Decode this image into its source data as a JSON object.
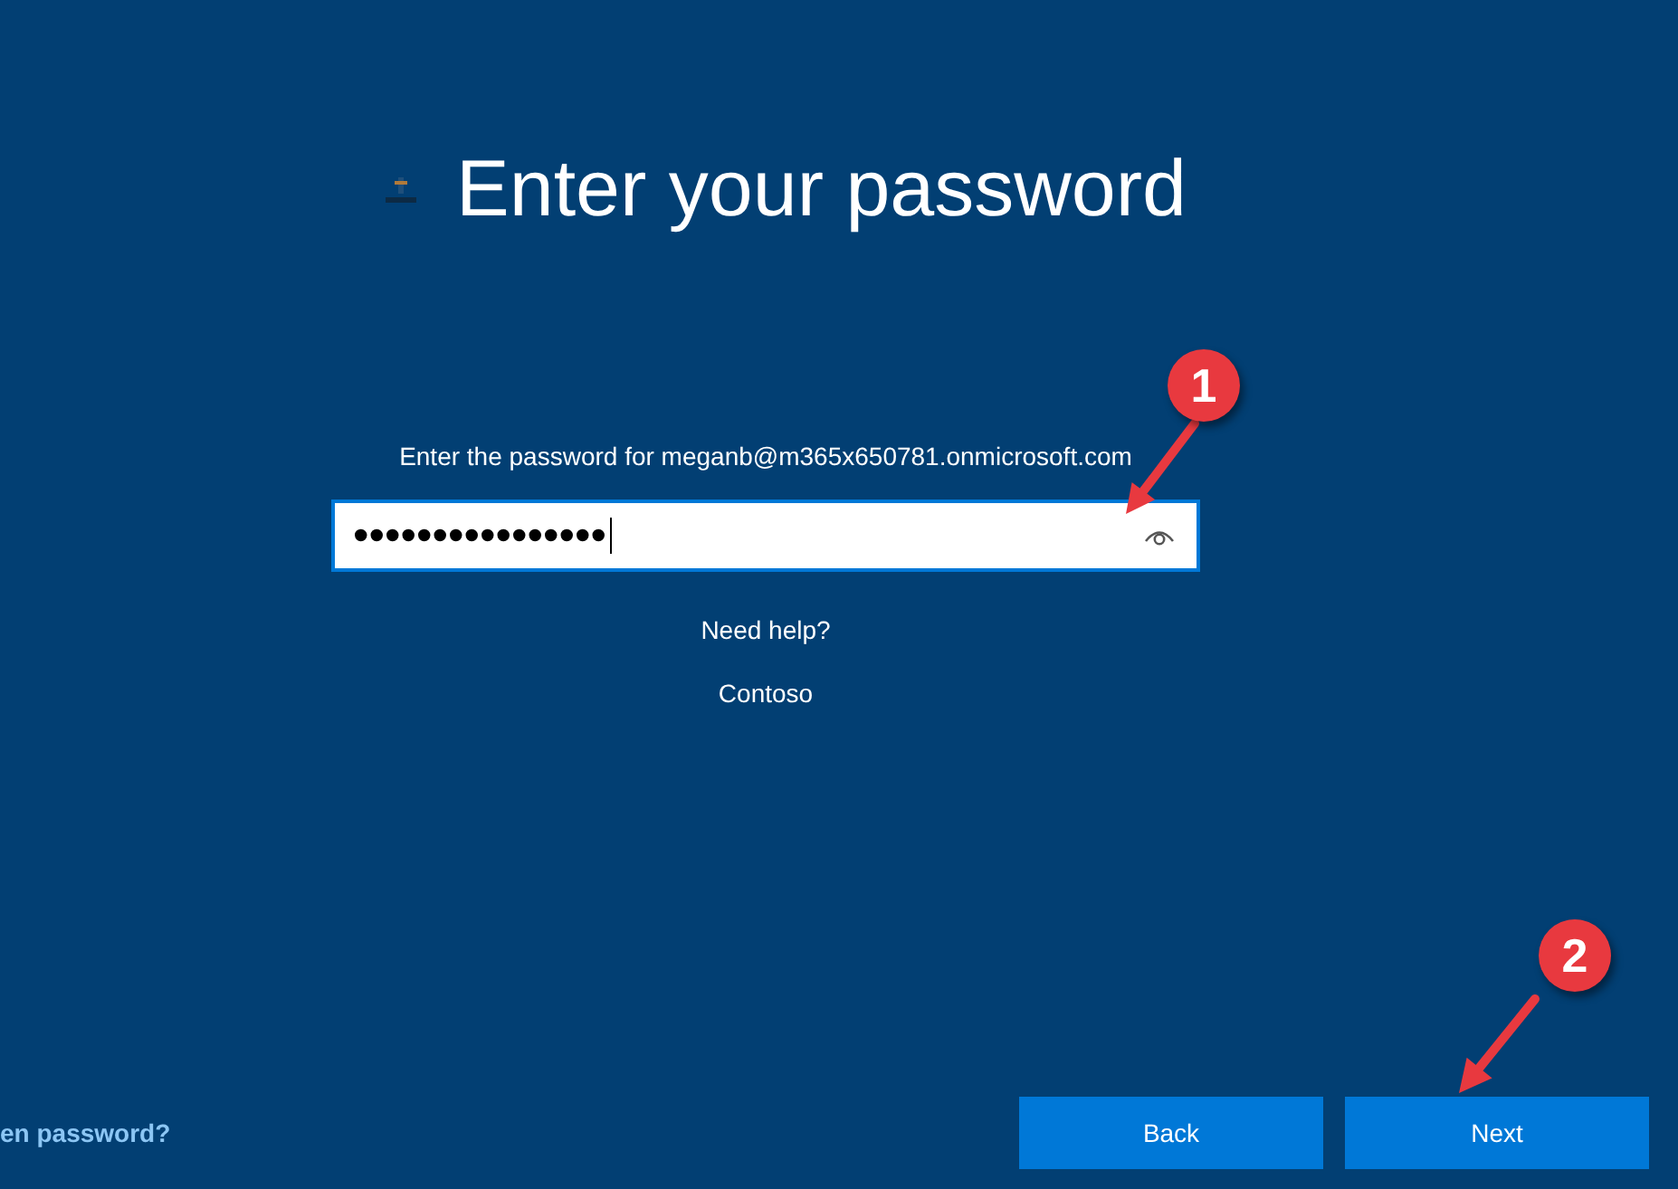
{
  "header": {
    "title": "Enter your password"
  },
  "prompt": "Enter the password for meganb@m365x650781.onmicrosoft.com",
  "password_field": {
    "value": "••••••••••••••••",
    "focused": true
  },
  "links": [
    {
      "label": "Need help?"
    },
    {
      "label": "Contoso"
    }
  ],
  "footer": {
    "link": "en password?",
    "buttons": [
      {
        "label": "Back"
      },
      {
        "label": "Next"
      }
    ]
  },
  "annotations": [
    {
      "label": "1"
    },
    {
      "label": "2"
    }
  ]
}
